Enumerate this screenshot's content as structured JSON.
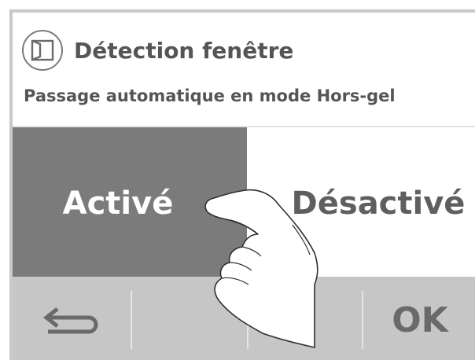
{
  "header": {
    "icon": "window-icon",
    "title": "Détection fenêtre",
    "subtitle": "Passage automatique en mode Hors-gel"
  },
  "options": {
    "active_label": "Activé",
    "inactive_label": "Désactivé",
    "selected": "Activé"
  },
  "footer": {
    "back_icon": "back-arrow-icon",
    "ok_label": "OK"
  },
  "colors": {
    "selected_bg": "#7b7b7b",
    "footer_bg": "#c6c6c6",
    "text": "#555555"
  }
}
